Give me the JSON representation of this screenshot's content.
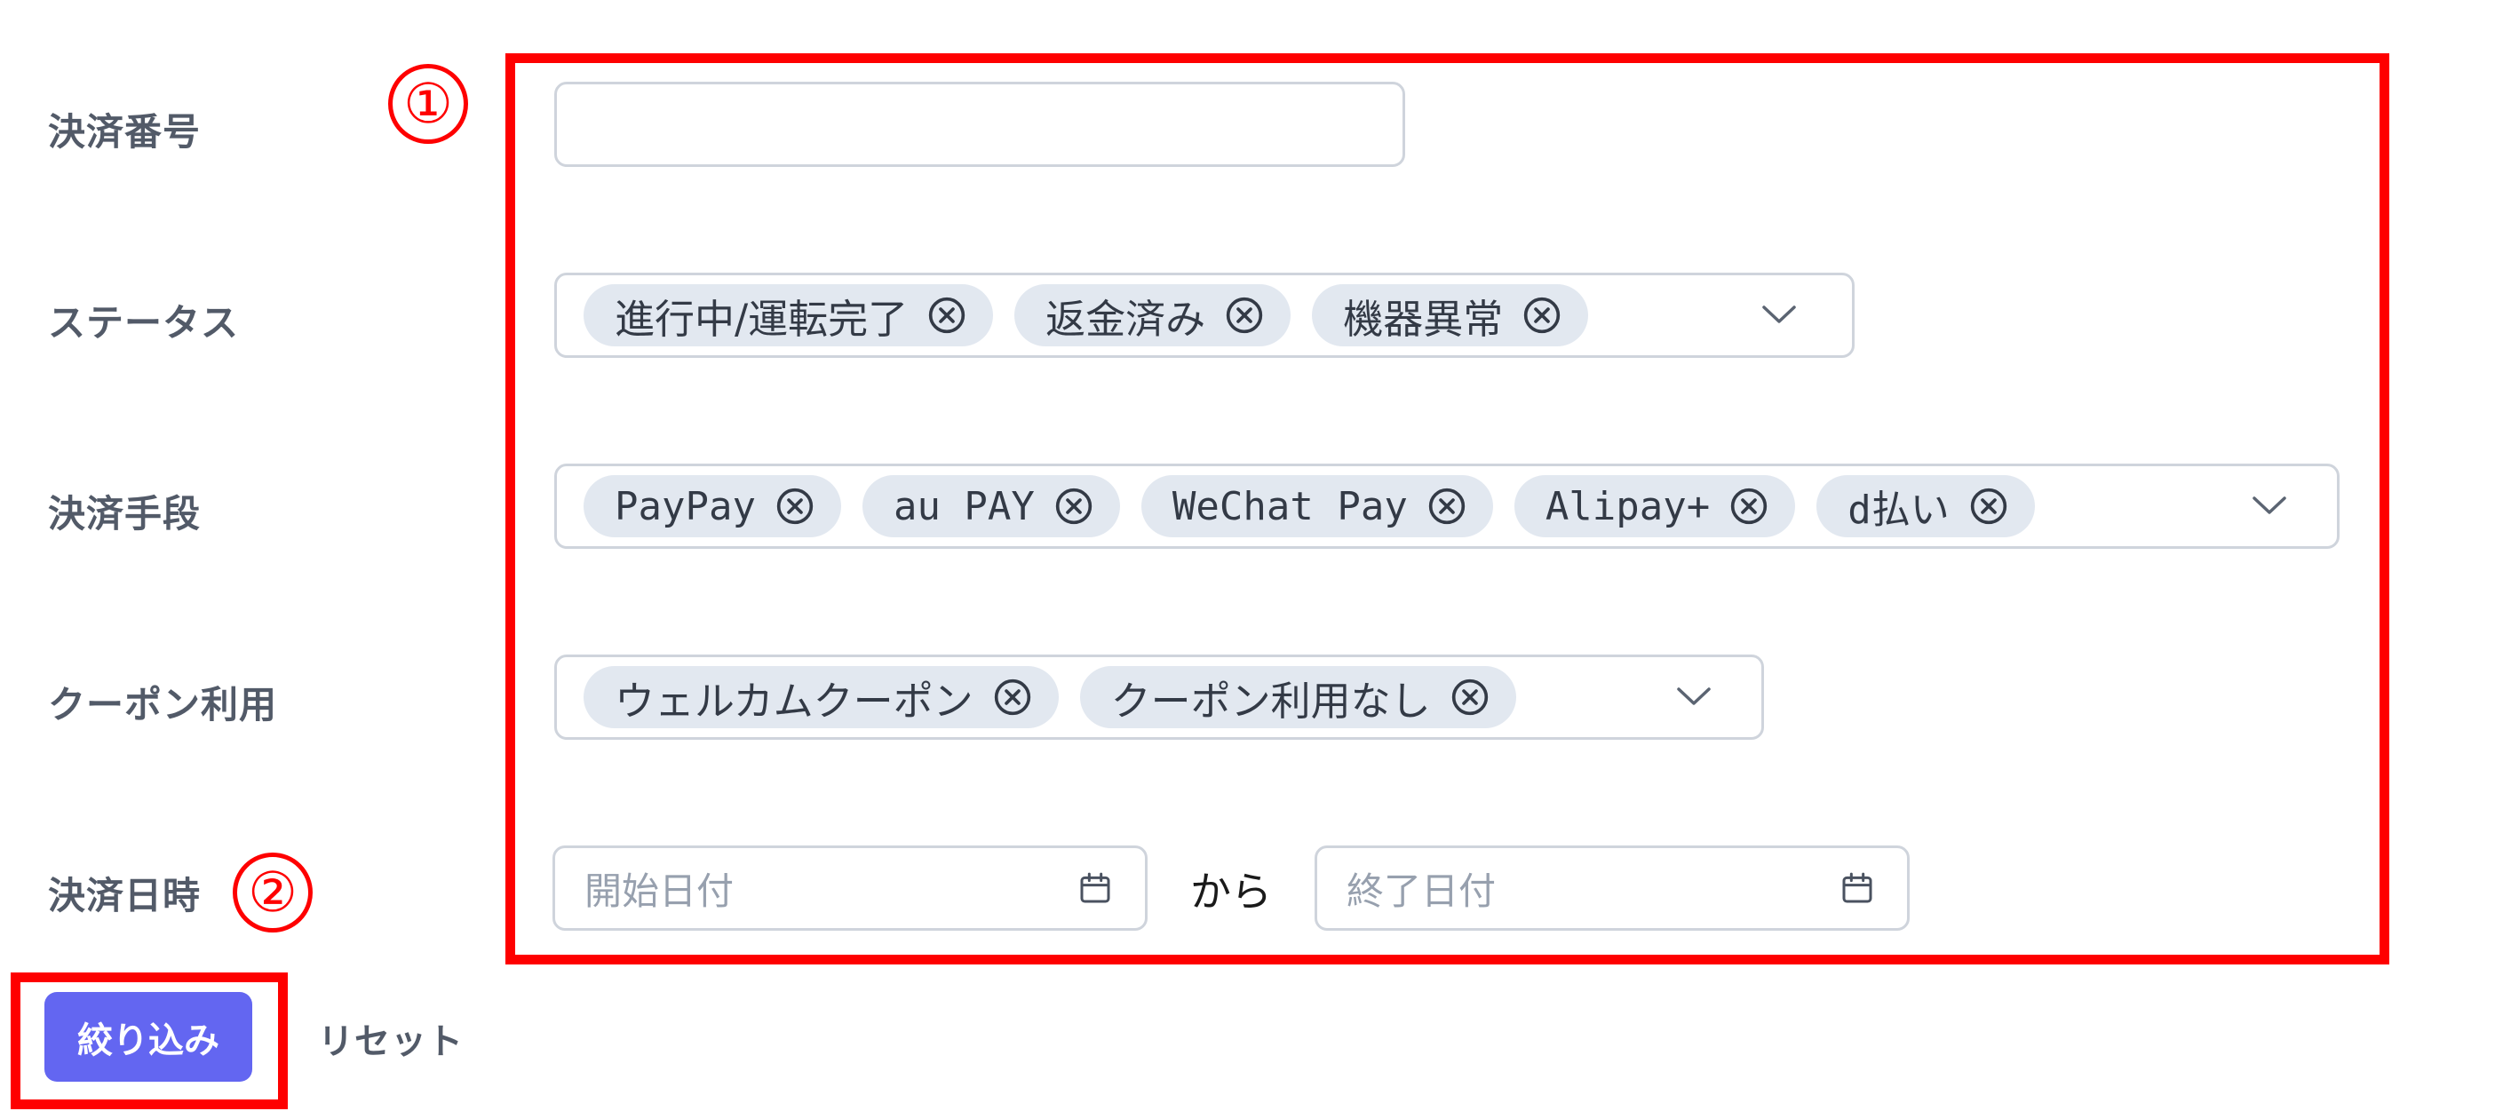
{
  "annotations": {
    "marker_1": "①",
    "marker_2": "②",
    "highlight_color": "#fe0000"
  },
  "form": {
    "payment_number": {
      "label": "決済番号",
      "value": ""
    },
    "status": {
      "label": "ステータス",
      "chips": [
        "進行中/運転完了",
        "返金済み",
        "機器異常"
      ]
    },
    "payment_method": {
      "label": "決済手段",
      "chips": [
        "PayPay",
        "au PAY",
        "WeChat Pay",
        "Alipay+",
        "d払い"
      ]
    },
    "coupon": {
      "label": "クーポン利用",
      "chips": [
        "ウェルカムクーポン",
        "クーポン利用なし"
      ]
    },
    "payment_datetime": {
      "label": "決済日時",
      "start_placeholder": "開始日付",
      "separator": "から",
      "end_placeholder": "終了日付"
    }
  },
  "actions": {
    "filter_label": "絞り込み",
    "reset_label": "リセット"
  },
  "colors": {
    "primary": "#6366f1",
    "chip_bg": "#e2e8f0",
    "label": "#525a68",
    "border": "#cfd4dc"
  },
  "icons": {
    "chip_remove": "circle-x-icon",
    "dropdown": "chevron-down-icon",
    "date": "calendar-icon"
  }
}
